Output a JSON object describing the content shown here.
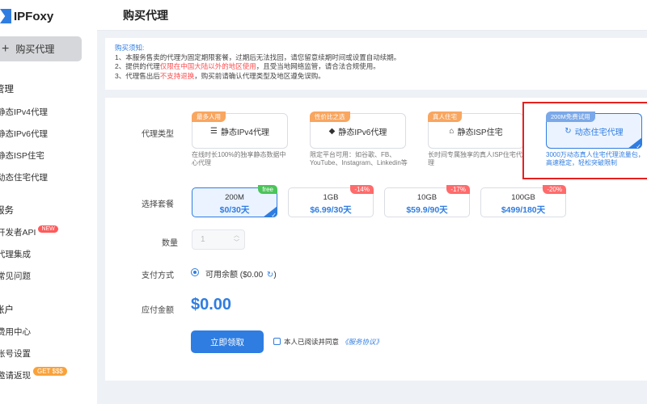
{
  "app": {
    "logo_text": "IPFoxy",
    "page_title": "购买代理"
  },
  "sidebar": {
    "buy_button": "购买代理",
    "section_manage": "管理",
    "manage_items": [
      "静态IPv4代理",
      "静态IPv6代理",
      "静态ISP住宅",
      "动态住宅代理"
    ],
    "section_service": "服务",
    "service_items": [
      "开发者API",
      "代理集成",
      "常见问题"
    ],
    "badge_new": "NEW",
    "section_account": "账户",
    "account_items": [
      "费用中心",
      "账号设置",
      "邀请返现"
    ],
    "badge_get": "GET $$$"
  },
  "notice": {
    "title": "购买须知:",
    "line1": "1、本服务售卖的代理为固定期限套餐，过期后无法找回，请您留意续期时间或设置自动续期。",
    "line2_a": "2、提供的代理",
    "line2_red": "仅限在中国大陆以外的地区使用",
    "line2_b": "，且受当地网络监管，请合法合规使用。",
    "line3_a": "3、代理售出后",
    "line3_red": "不支持退换",
    "line3_b": "，购买前请确认代理类型及地区遵免误购。"
  },
  "form": {
    "proxy_type_label": "代理类型",
    "package_label": "选择套餐",
    "quantity_label": "数量",
    "payment_label": "支付方式",
    "total_label": "应付金额"
  },
  "proxy_types": [
    {
      "tag": "最多人用",
      "name": "静态IPv4代理",
      "icon": "list-icon",
      "desc": "在线时长100%的独享静态数据中心代理"
    },
    {
      "tag": "性价比之选",
      "name": "静态IPv6代理",
      "icon": "stack-icon",
      "desc": "限定平台可用：如谷歌、FB、YouTube、Instagram、Linkedin等"
    },
    {
      "tag": "真人住宅",
      "name": "静态ISP住宅",
      "icon": "home-icon",
      "desc": "长时间专属独享的真人ISP住宅代理"
    },
    {
      "tag": "200M免费试用",
      "name": "动态住宅代理",
      "icon": "refresh-icon",
      "desc": "3000万动态真人住宅代理流量包，高速稳定，轻松突破限制"
    }
  ],
  "packages": [
    {
      "size": "200M",
      "price": "$0/30天",
      "tag": "free"
    },
    {
      "size": "1GB",
      "price": "$6.99/30天",
      "tag": "-14%"
    },
    {
      "size": "10GB",
      "price": "$59.9/90天",
      "tag": "-17%"
    },
    {
      "size": "100GB",
      "price": "$499/180天",
      "tag": "-20%"
    }
  ],
  "quantity": {
    "value": "1"
  },
  "payment": {
    "text": "可用余额 ($0.00",
    "close": ")"
  },
  "total": {
    "amount": "$0.00"
  },
  "submit": {
    "label": "立即领取"
  },
  "agreement": {
    "text": "本人已阅读并同意",
    "link": "《服务协议》"
  },
  "colors": {
    "accent": "#2f7de1",
    "tag_orange": "#f8a660",
    "discount_red": "#ff6b6b",
    "free_green": "#4cc45a",
    "highlight_red": "#e62020"
  }
}
